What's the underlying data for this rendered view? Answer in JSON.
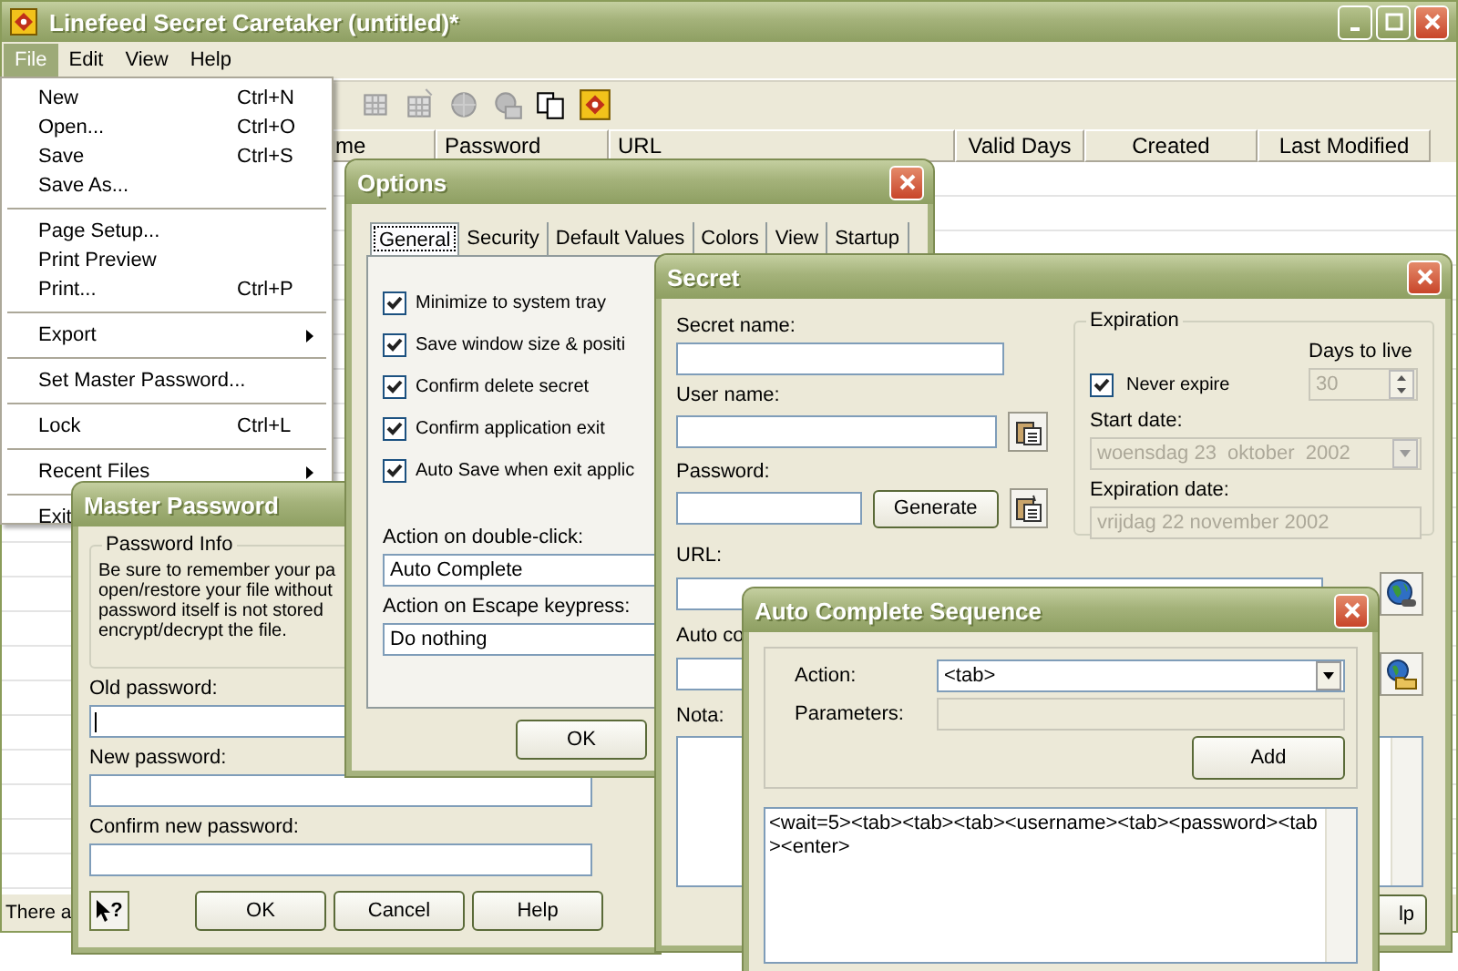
{
  "window": {
    "title": "Linefeed Secret Caretaker (untitled)*"
  },
  "menu_bar": [
    {
      "label": "File",
      "selected": true
    },
    {
      "label": "Edit",
      "selected": false
    },
    {
      "label": "View",
      "selected": false
    },
    {
      "label": "Help",
      "selected": false
    }
  ],
  "file_menu": [
    {
      "kind": "item",
      "label": "New",
      "shortcut": "Ctrl+N"
    },
    {
      "kind": "item",
      "label": "Open...",
      "shortcut": "Ctrl+O"
    },
    {
      "kind": "item",
      "label": "Save",
      "shortcut": "Ctrl+S"
    },
    {
      "kind": "item",
      "label": "Save As..."
    },
    {
      "kind": "separator"
    },
    {
      "kind": "item",
      "label": "Page Setup..."
    },
    {
      "kind": "item",
      "label": "Print Preview"
    },
    {
      "kind": "item",
      "label": "Print...",
      "shortcut": "Ctrl+P"
    },
    {
      "kind": "separator"
    },
    {
      "kind": "submenu",
      "label": "Export"
    },
    {
      "kind": "separator"
    },
    {
      "kind": "item",
      "label": "Set Master Password..."
    },
    {
      "kind": "separator"
    },
    {
      "kind": "item",
      "label": "Lock",
      "shortcut": "Ctrl+L"
    },
    {
      "kind": "separator"
    },
    {
      "kind": "submenu",
      "label": "Recent Files"
    },
    {
      "kind": "separator"
    },
    {
      "kind": "item",
      "label": "Exit"
    }
  ],
  "table": {
    "columns": [
      "me",
      "Password",
      "URL",
      "Valid Days",
      "Created",
      "Last Modified"
    ]
  },
  "status_bar": {
    "text": "There a"
  },
  "master_password": {
    "title": "Master Password",
    "group": "Password Info",
    "info": "Be sure to remember your pa\nopen/restore your file without\npassword itself is not stored\nencrypt/decrypt the file.",
    "fields": [
      {
        "label": "Old password:",
        "focused": true
      },
      {
        "label": "New password:",
        "focused": false
      },
      {
        "label": "Confirm new password:",
        "focused": false
      }
    ],
    "help_symbol": "?",
    "buttons": [
      "OK",
      "Cancel",
      "Help"
    ]
  },
  "options": {
    "title": "Options",
    "tabs": [
      {
        "label": "General",
        "selected": true
      },
      {
        "label": "Security",
        "selected": false
      },
      {
        "label": "Default Values",
        "selected": false
      },
      {
        "label": "Colors",
        "selected": false
      },
      {
        "label": "View",
        "selected": false
      },
      {
        "label": "Startup",
        "selected": false
      }
    ],
    "checkboxes": [
      {
        "label": "Minimize to system tray",
        "checked": true
      },
      {
        "label": "Save window size & positi",
        "checked": true
      },
      {
        "label": "Confirm delete secret",
        "checked": true
      },
      {
        "label": "Confirm application exit",
        "checked": true
      },
      {
        "label": "Auto Save when exit applic",
        "checked": true
      }
    ],
    "selects": [
      {
        "label": "Action on double-click:",
        "value": "Auto Complete"
      },
      {
        "label": "Action on Escape keypress:",
        "value": "Do nothing"
      }
    ],
    "buttons": [
      "OK"
    ]
  },
  "secret": {
    "title": "Secret",
    "secret_name_label": "Secret name:",
    "user_name_label": "User name:",
    "password_label": "Password:",
    "generate_button": "Generate",
    "url_label": "URL:",
    "auto_complete_label": "Auto co",
    "nota_label": "Nota:",
    "help_button": "lp",
    "expiration": {
      "title": "Expiration",
      "never_expire": {
        "label": "Never expire",
        "checked": true
      },
      "days_label": "Days to live",
      "days_value": "30",
      "days_disabled": true,
      "start_label": "Start date:",
      "start_value": "woensdag 23  oktober  2002",
      "start_disabled": true,
      "exp_label": "Expiration date:",
      "exp_value": "vrijdag 22 november 2002",
      "exp_disabled": true
    }
  },
  "auto_complete": {
    "title": "Auto Complete Sequence",
    "action_label": "Action:",
    "action_value": "<tab>",
    "parameters_label": "Parameters:",
    "parameters_disabled": true,
    "add_button": "Add",
    "sequence": "<wait=5><tab><tab><tab><username><tab><password><tab><enter>"
  }
}
